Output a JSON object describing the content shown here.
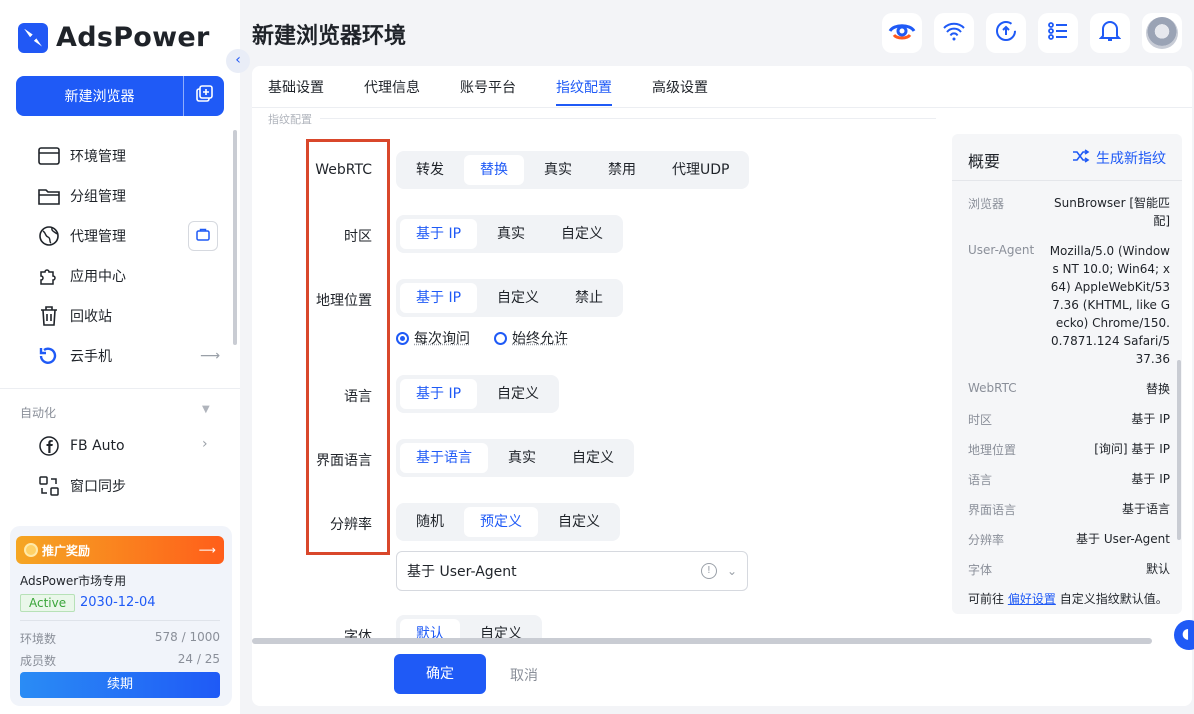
{
  "app": {
    "brand": "AdsPower",
    "new_browser": "新建浏览器"
  },
  "sidebar": {
    "items": [
      {
        "label": "环境管理",
        "icon": "browser-window-icon"
      },
      {
        "label": "分组管理",
        "icon": "folder-icon"
      },
      {
        "label": "代理管理",
        "icon": "globe-icon"
      },
      {
        "label": "应用中心",
        "icon": "puzzle-icon"
      },
      {
        "label": "回收站",
        "icon": "trash-icon"
      },
      {
        "label": "云手机",
        "icon": "cloud-phone-icon"
      }
    ],
    "automation_label": "自动化",
    "automation_items": [
      {
        "label": "FB Auto",
        "icon": "facebook-icon"
      },
      {
        "label": "窗口同步",
        "icon": "sync-icon"
      }
    ]
  },
  "promo": {
    "header": "推广奖励",
    "title": "AdsPower市场专用",
    "status": "Active",
    "expiry": "2030-12-04",
    "env_label": "环境数",
    "env_value": "578 / 1000",
    "member_label": "成员数",
    "member_value": "24 / 25",
    "renew": "续期"
  },
  "header": {
    "title": "新建浏览器环境"
  },
  "tabs": [
    "基础设置",
    "代理信息",
    "账号平台",
    "指纹配置",
    "高级设置"
  ],
  "section_label": "指纹配置",
  "fields": {
    "webrtc": {
      "label": "WebRTC",
      "options": [
        "转发",
        "替换",
        "真实",
        "禁用",
        "代理UDP"
      ],
      "selected": "替换"
    },
    "timezone": {
      "label": "时区",
      "options": [
        "基于 IP",
        "真实",
        "自定义"
      ],
      "selected": "基于 IP"
    },
    "geo": {
      "label": "地理位置",
      "options": [
        "基于 IP",
        "自定义",
        "禁止"
      ],
      "selected": "基于 IP",
      "radio": [
        "每次询问",
        "始终允许"
      ],
      "radio_selected": "每次询问"
    },
    "language": {
      "label": "语言",
      "options": [
        "基于 IP",
        "自定义"
      ],
      "selected": "基于 IP"
    },
    "ui_language": {
      "label": "界面语言",
      "options": [
        "基于语言",
        "真实",
        "自定义"
      ],
      "selected": "基于语言"
    },
    "resolution": {
      "label": "分辨率",
      "options": [
        "随机",
        "预定义",
        "自定义"
      ],
      "selected": "预定义",
      "select_value": "基于 User-Agent"
    },
    "font": {
      "label": "字体",
      "options": [
        "默认",
        "自定义"
      ],
      "selected": "默认"
    }
  },
  "summary": {
    "title": "概要",
    "generate": "生成新指纹",
    "rows": [
      {
        "k": "浏览器",
        "v": "SunBrowser [智能匹配]"
      },
      {
        "k": "User-Agent",
        "v": "Mozilla/5.0 (Windows NT 10.0; Win64; x64) AppleWebKit/537.36 (KHTML, like Gecko) Chrome/150.0.7871.124 Safari/537.36"
      },
      {
        "k": "WebRTC",
        "v": "替换"
      },
      {
        "k": "时区",
        "v": "基于 IP"
      },
      {
        "k": "地理位置",
        "v": "[询问] 基于 IP"
      },
      {
        "k": "语言",
        "v": "基于 IP"
      },
      {
        "k": "界面语言",
        "v": "基于语言"
      },
      {
        "k": "分辨率",
        "v": "基于 User-Agent"
      },
      {
        "k": "字体",
        "v": "默认"
      }
    ],
    "foot_pre": "可前往",
    "foot_link": "偏好设置",
    "foot_post": "自定义指纹默认值。"
  },
  "actions": {
    "ok": "确定",
    "cancel": "取消"
  },
  "colors": {
    "accent": "#1f5af6",
    "highlight_box": "#d9472b"
  }
}
